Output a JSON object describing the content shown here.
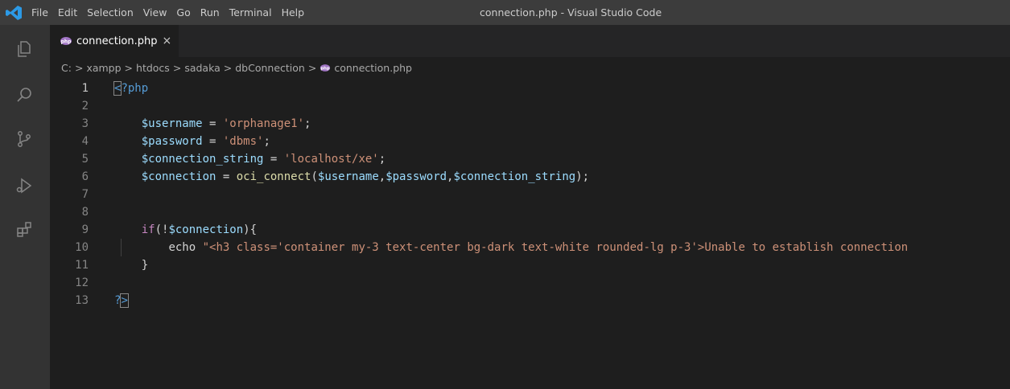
{
  "titlebar": {
    "menu": [
      "File",
      "Edit",
      "Selection",
      "View",
      "Go",
      "Run",
      "Terminal",
      "Help"
    ],
    "title": "connection.php - Visual Studio Code"
  },
  "tab": {
    "label": "connection.php",
    "close": "×"
  },
  "breadcrumb": {
    "parts": [
      "C:",
      "xampp",
      "htdocs",
      "sadaka",
      "dbConnection",
      "connection.php"
    ],
    "sep": ">"
  },
  "editor": {
    "lines": [
      {
        "num": "1",
        "tokens": [
          [
            "tag",
            "<?php"
          ]
        ]
      },
      {
        "num": "2",
        "tokens": []
      },
      {
        "num": "3",
        "tokens": [
          [
            "op",
            "    "
          ],
          [
            "var",
            "$username"
          ],
          [
            "op",
            " = "
          ],
          [
            "str",
            "'orphanage1'"
          ],
          [
            "op",
            ";"
          ]
        ]
      },
      {
        "num": "4",
        "tokens": [
          [
            "op",
            "    "
          ],
          [
            "var",
            "$password"
          ],
          [
            "op",
            " = "
          ],
          [
            "str",
            "'dbms'"
          ],
          [
            "op",
            ";"
          ]
        ]
      },
      {
        "num": "5",
        "tokens": [
          [
            "op",
            "    "
          ],
          [
            "var",
            "$connection_string"
          ],
          [
            "op",
            " = "
          ],
          [
            "str",
            "'localhost/xe'"
          ],
          [
            "op",
            ";"
          ]
        ]
      },
      {
        "num": "6",
        "tokens": [
          [
            "op",
            "    "
          ],
          [
            "var",
            "$connection"
          ],
          [
            "op",
            " = "
          ],
          [
            "fn",
            "oci_connect"
          ],
          [
            "op",
            "("
          ],
          [
            "var",
            "$username"
          ],
          [
            "op",
            ","
          ],
          [
            "var",
            "$password"
          ],
          [
            "op",
            ","
          ],
          [
            "var",
            "$connection_string"
          ],
          [
            "op",
            ");"
          ]
        ]
      },
      {
        "num": "7",
        "tokens": []
      },
      {
        "num": "8",
        "tokens": []
      },
      {
        "num": "9",
        "tokens": [
          [
            "op",
            "    "
          ],
          [
            "kw",
            "if"
          ],
          [
            "op",
            "(!"
          ],
          [
            "var",
            "$connection"
          ],
          [
            "op",
            "){"
          ]
        ]
      },
      {
        "num": "10",
        "tokens": [
          [
            "op",
            "        "
          ],
          [
            "op",
            "echo "
          ],
          [
            "str",
            "\"<h3 class='container my-3 text-center bg-dark text-white rounded-lg p-3'>Unable to establish connection"
          ]
        ]
      },
      {
        "num": "11",
        "tokens": [
          [
            "op",
            "    "
          ],
          [
            "op",
            "}"
          ]
        ]
      },
      {
        "num": "12",
        "tokens": []
      },
      {
        "num": "13",
        "tokens": [
          [
            "tag",
            "?>"
          ]
        ]
      }
    ]
  }
}
